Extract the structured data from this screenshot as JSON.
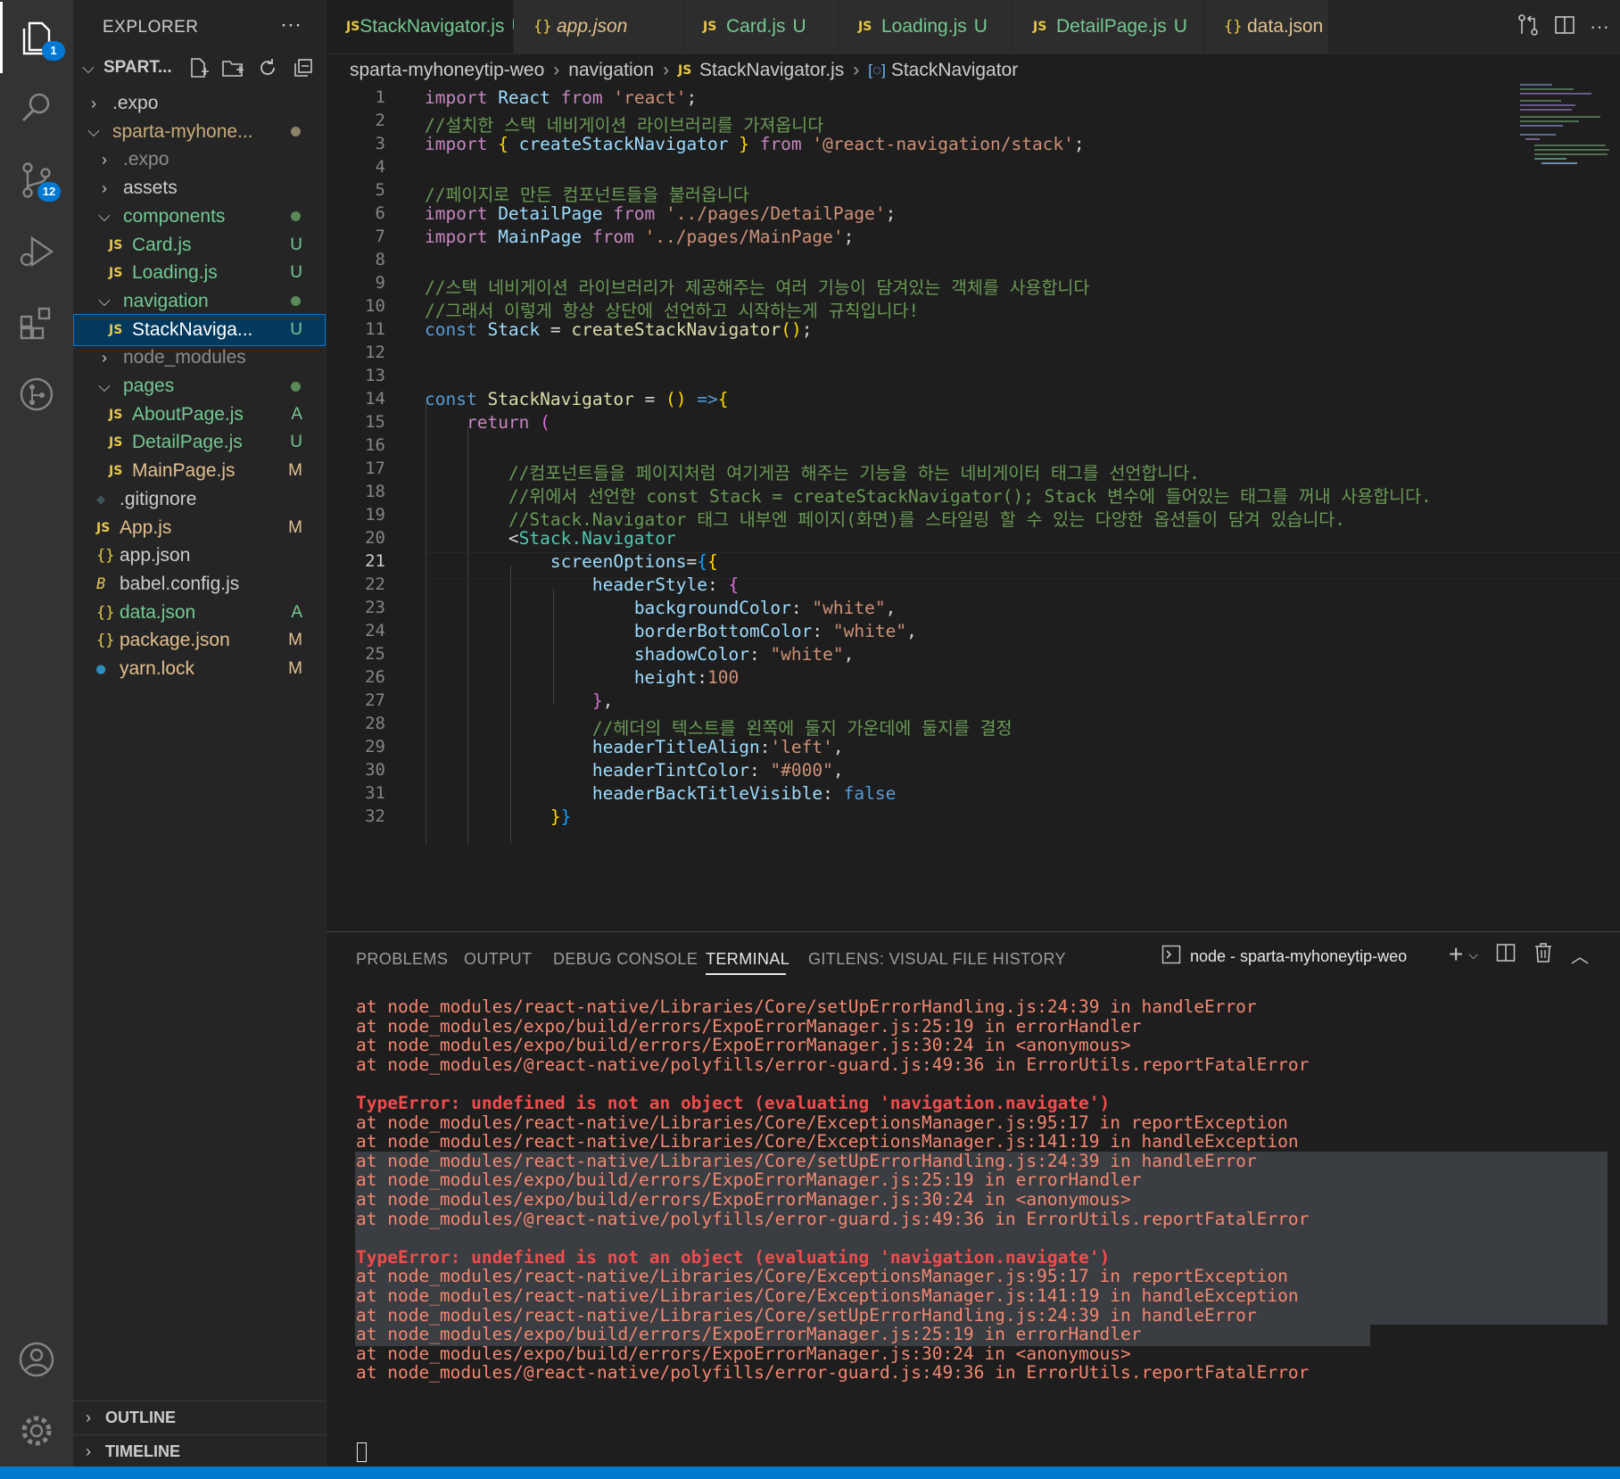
{
  "activity": {
    "explorer_badge": "1",
    "scm_badge": "12"
  },
  "explorer": {
    "title": "EXPLORER",
    "more": "···",
    "project": "SPART...",
    "tree": [
      {
        "label": ".expo",
        "kind": "folder-closed",
        "depth": 1,
        "status": "",
        "color": "#cccccc"
      },
      {
        "label": "sparta-myhone...",
        "kind": "folder-open",
        "depth": 1,
        "status": "dot",
        "color": "#c9ad7a"
      },
      {
        "label": ".expo",
        "kind": "folder-closed",
        "depth": 2,
        "status": "",
        "color": "#8c8c8c"
      },
      {
        "label": "assets",
        "kind": "folder-closed",
        "depth": 2,
        "status": "",
        "color": "#cccccc"
      },
      {
        "label": "components",
        "kind": "folder-open",
        "depth": 2,
        "status": "dot-green",
        "color": "#73c991"
      },
      {
        "label": "Card.js",
        "kind": "js",
        "depth": 3,
        "status": "U",
        "color": "#73c991"
      },
      {
        "label": "Loading.js",
        "kind": "js",
        "depth": 3,
        "status": "U",
        "color": "#73c991"
      },
      {
        "label": "navigation",
        "kind": "folder-open",
        "depth": 2,
        "status": "dot-green",
        "color": "#73c991"
      },
      {
        "label": "StackNaviga...",
        "kind": "js",
        "depth": 3,
        "status": "U",
        "color": "#ffffff",
        "selected": true
      },
      {
        "label": "node_modules",
        "kind": "folder-closed",
        "depth": 2,
        "status": "",
        "color": "#8c8c8c"
      },
      {
        "label": "pages",
        "kind": "folder-open",
        "depth": 2,
        "status": "dot-green",
        "color": "#73c991"
      },
      {
        "label": "AboutPage.js",
        "kind": "js",
        "depth": 3,
        "status": "A",
        "color": "#73c991"
      },
      {
        "label": "DetailPage.js",
        "kind": "js",
        "depth": 3,
        "status": "U",
        "color": "#73c991"
      },
      {
        "label": "MainPage.js",
        "kind": "js",
        "depth": 3,
        "status": "M",
        "color": "#e2c08d"
      },
      {
        "label": ".gitignore",
        "kind": "git",
        "depth": 2,
        "status": "",
        "color": "#cccccc"
      },
      {
        "label": "App.js",
        "kind": "js",
        "depth": 2,
        "status": "M",
        "color": "#e2c08d"
      },
      {
        "label": "app.json",
        "kind": "json",
        "depth": 2,
        "status": "",
        "color": "#cccccc"
      },
      {
        "label": "babel.config.js",
        "kind": "babel",
        "depth": 2,
        "status": "",
        "color": "#cccccc"
      },
      {
        "label": "data.json",
        "kind": "json",
        "depth": 2,
        "status": "A",
        "color": "#73c991"
      },
      {
        "label": "package.json",
        "kind": "json",
        "depth": 2,
        "status": "M",
        "color": "#e2c08d"
      },
      {
        "label": "yarn.lock",
        "kind": "yarn",
        "depth": 2,
        "status": "M",
        "color": "#e2c08d"
      }
    ],
    "outline": "OUTLINE",
    "timeline": "TIMELINE"
  },
  "tabs": [
    {
      "label": "StackNavigator.js",
      "icon": "JS",
      "status": "U",
      "close": "✕",
      "active": true
    },
    {
      "label": "app.json",
      "icon": "{}",
      "status": "",
      "italic": true
    },
    {
      "label": "Card.js",
      "icon": "JS",
      "status": "U"
    },
    {
      "label": "Loading.js",
      "icon": "JS",
      "status": "U"
    },
    {
      "label": "DetailPage.js",
      "icon": "JS",
      "status": "U"
    },
    {
      "label": "data.json",
      "icon": "{}",
      "status": ""
    }
  ],
  "breadcrumb": {
    "root": "sparta-myhoneytip-weo",
    "folder": "navigation",
    "file": "StackNavigator.js",
    "symbol": "StackNavigator"
  },
  "editor": {
    "current_line": 21,
    "lines": [
      [
        [
          "kw2",
          "import "
        ],
        [
          "var",
          "React "
        ],
        [
          "kw2",
          "from "
        ],
        [
          "str",
          "'react'"
        ],
        [
          "pun",
          ";"
        ]
      ],
      [
        [
          "cmt",
          "//설치한 스택 네비게이션 라이브러리를 가져옵니다"
        ]
      ],
      [
        [
          "kw2",
          "import "
        ],
        [
          "br1",
          "{ "
        ],
        [
          "var",
          "createStackNavigator "
        ],
        [
          "br1",
          "} "
        ],
        [
          "kw2",
          "from "
        ],
        [
          "str",
          "'@react-navigation/stack'"
        ],
        [
          "pun",
          ";"
        ]
      ],
      [],
      [
        [
          "cmt",
          "//페이지로 만든 컴포넌트들을 불러옵니다"
        ]
      ],
      [
        [
          "kw2",
          "import "
        ],
        [
          "var",
          "DetailPage "
        ],
        [
          "kw2",
          "from "
        ],
        [
          "str",
          "'../pages/DetailPage'"
        ],
        [
          "pun",
          ";"
        ]
      ],
      [
        [
          "kw2",
          "import "
        ],
        [
          "var",
          "MainPage "
        ],
        [
          "kw2",
          "from "
        ],
        [
          "str",
          "'../pages/MainPage'"
        ],
        [
          "pun",
          ";"
        ]
      ],
      [],
      [
        [
          "cmt",
          "//스택 네비게이션 라이브러리가 제공해주는 여러 기능이 담겨있는 객체를 사용합니다"
        ]
      ],
      [
        [
          "cmt",
          "//그래서 이렇게 항상 상단에 선언하고 시작하는게 규칙입니다!"
        ]
      ],
      [
        [
          "kw",
          "const "
        ],
        [
          "var",
          "Stack "
        ],
        [
          "pun",
          "= "
        ],
        [
          "fn",
          "createStackNavigator"
        ],
        [
          "br1",
          "()"
        ],
        [
          "pun",
          ";"
        ]
      ],
      [],
      [],
      [
        [
          "kw",
          "const "
        ],
        [
          "fn",
          "StackNavigator "
        ],
        [
          "pun",
          "= "
        ],
        [
          "br1",
          "() "
        ],
        [
          "kw",
          "=>"
        ],
        [
          "br1",
          "{"
        ]
      ],
      [
        [
          "pun",
          "    "
        ],
        [
          "kw2",
          "return "
        ],
        [
          "br2",
          "("
        ]
      ],
      [],
      [
        [
          "pun",
          "        "
        ],
        [
          "cmt",
          "//컴포넌트들을 페이지처럼 여기게끔 해주는 기능을 하는 네비게이터 태그를 선언합니다."
        ]
      ],
      [
        [
          "pun",
          "        "
        ],
        [
          "cmt",
          "//위에서 선언한 const Stack = createStackNavigator(); Stack 변수에 들어있는 태그를 꺼내 사용합니다."
        ]
      ],
      [
        [
          "pun",
          "        "
        ],
        [
          "cmt",
          "//Stack.Navigator 태그 내부엔 페이지(화면)를 스타일링 할 수 있는 다양한 옵션들이 담겨 있습니다."
        ]
      ],
      [
        [
          "pun",
          "        "
        ],
        [
          "pun",
          "<"
        ],
        [
          "typ",
          "Stack.Navigator"
        ]
      ],
      [
        [
          "pun",
          "            "
        ],
        [
          "var",
          "screenOptions"
        ],
        [
          "pun",
          "="
        ],
        [
          "br3",
          "{"
        ],
        [
          "br1",
          "{"
        ]
      ],
      [
        [
          "pun",
          "                "
        ],
        [
          "var",
          "headerStyle"
        ],
        [
          "pun",
          ": "
        ],
        [
          "br2",
          "{"
        ]
      ],
      [
        [
          "pun",
          "                    "
        ],
        [
          "var",
          "backgroundColor"
        ],
        [
          "pun",
          ": "
        ],
        [
          "str",
          "\"white\""
        ],
        [
          "pun",
          ","
        ]
      ],
      [
        [
          "pun",
          "                    "
        ],
        [
          "var",
          "borderBottomColor"
        ],
        [
          "pun",
          ": "
        ],
        [
          "str",
          "\"white\""
        ],
        [
          "pun",
          ","
        ]
      ],
      [
        [
          "pun",
          "                    "
        ],
        [
          "var",
          "shadowColor"
        ],
        [
          "pun",
          ": "
        ],
        [
          "str",
          "\"white\""
        ],
        [
          "pun",
          ","
        ]
      ],
      [
        [
          "pun",
          "                    "
        ],
        [
          "var",
          "height"
        ],
        [
          "pun",
          ":"
        ],
        [
          "str",
          "100"
        ]
      ],
      [
        [
          "pun",
          "                "
        ],
        [
          "br2",
          "}"
        ],
        [
          "pun",
          ","
        ]
      ],
      [
        [
          "pun",
          "                "
        ],
        [
          "cmt",
          "//헤더의 텍스트를 왼쪽에 둘지 가운데에 둘지를 결정"
        ]
      ],
      [
        [
          "pun",
          "                "
        ],
        [
          "var",
          "headerTitleAlign"
        ],
        [
          "pun",
          ":"
        ],
        [
          "str",
          "'left'"
        ],
        [
          "pun",
          ","
        ]
      ],
      [
        [
          "pun",
          "                "
        ],
        [
          "var",
          "headerTintColor"
        ],
        [
          "pun",
          ": "
        ],
        [
          "str",
          "\"#000\""
        ],
        [
          "pun",
          ","
        ]
      ],
      [
        [
          "pun",
          "                "
        ],
        [
          "var",
          "headerBackTitleVisible"
        ],
        [
          "pun",
          ": "
        ],
        [
          "kw",
          "false"
        ]
      ],
      [
        [
          "pun",
          "            "
        ],
        [
          "br1",
          "}"
        ],
        [
          "br3",
          "}"
        ]
      ]
    ]
  },
  "panel": {
    "tabs": [
      "PROBLEMS",
      "OUTPUT",
      "DEBUG CONSOLE",
      "TERMINAL",
      "GITLENS: VISUAL FILE HISTORY"
    ],
    "active_tab": "TERMINAL",
    "terminal_name": "node - sparta-myhoneytip-weo",
    "lines": [
      {
        "t": "at node_modules/react-native/Libraries/Core/setUpErrorHandling.js:24:39 in handleError",
        "k": "n"
      },
      {
        "t": "at node_modules/expo/build/errors/ExpoErrorManager.js:25:19 in errorHandler",
        "k": "n"
      },
      {
        "t": "at node_modules/expo/build/errors/ExpoErrorManager.js:30:24 in <anonymous>",
        "k": "n"
      },
      {
        "t": "at node_modules/@react-native/polyfills/error-guard.js:49:36 in ErrorUtils.reportFatalError",
        "k": "n"
      },
      {
        "t": "",
        "k": "n"
      },
      {
        "t": "TypeError: undefined is not an object (evaluating 'navigation.navigate')",
        "k": "e"
      },
      {
        "t": "at node_modules/react-native/Libraries/Core/ExceptionsManager.js:95:17 in reportException",
        "k": "n"
      },
      {
        "t": "at node_modules/react-native/Libraries/Core/ExceptionsManager.js:141:19 in handleException",
        "k": "n"
      },
      {
        "t": "at node_modules/react-native/Libraries/Core/setUpErrorHandling.js:24:39 in handleError",
        "k": "n"
      },
      {
        "t": "at node_modules/expo/build/errors/ExpoErrorManager.js:25:19 in errorHandler",
        "k": "n"
      },
      {
        "t": "at node_modules/expo/build/errors/ExpoErrorManager.js:30:24 in <anonymous>",
        "k": "n"
      },
      {
        "t": "at node_modules/@react-native/polyfills/error-guard.js:49:36 in ErrorUtils.reportFatalError",
        "k": "n"
      },
      {
        "t": "",
        "k": "n"
      },
      {
        "t": "TypeError: undefined is not an object (evaluating 'navigation.navigate')",
        "k": "e"
      },
      {
        "t": "at node_modules/react-native/Libraries/Core/ExceptionsManager.js:95:17 in reportException",
        "k": "n"
      },
      {
        "t": "at node_modules/react-native/Libraries/Core/ExceptionsManager.js:141:19 in handleException",
        "k": "n"
      },
      {
        "t": "at node_modules/react-native/Libraries/Core/setUpErrorHandling.js:24:39 in handleError",
        "k": "n"
      },
      {
        "t": "at node_modules/expo/build/errors/ExpoErrorManager.js:25:19 in errorHandler",
        "k": "n"
      },
      {
        "t": "at node_modules/expo/build/errors/ExpoErrorManager.js:30:24 in <anonymous>",
        "k": "n"
      },
      {
        "t": "at node_modules/@react-native/polyfills/error-guard.js:49:36 in ErrorUtils.reportFatalError",
        "k": "n"
      }
    ]
  },
  "colors": {
    "accent": "#007acc",
    "untracked": "#73c991",
    "modified": "#e2c08d",
    "error": "#f14c4c"
  }
}
